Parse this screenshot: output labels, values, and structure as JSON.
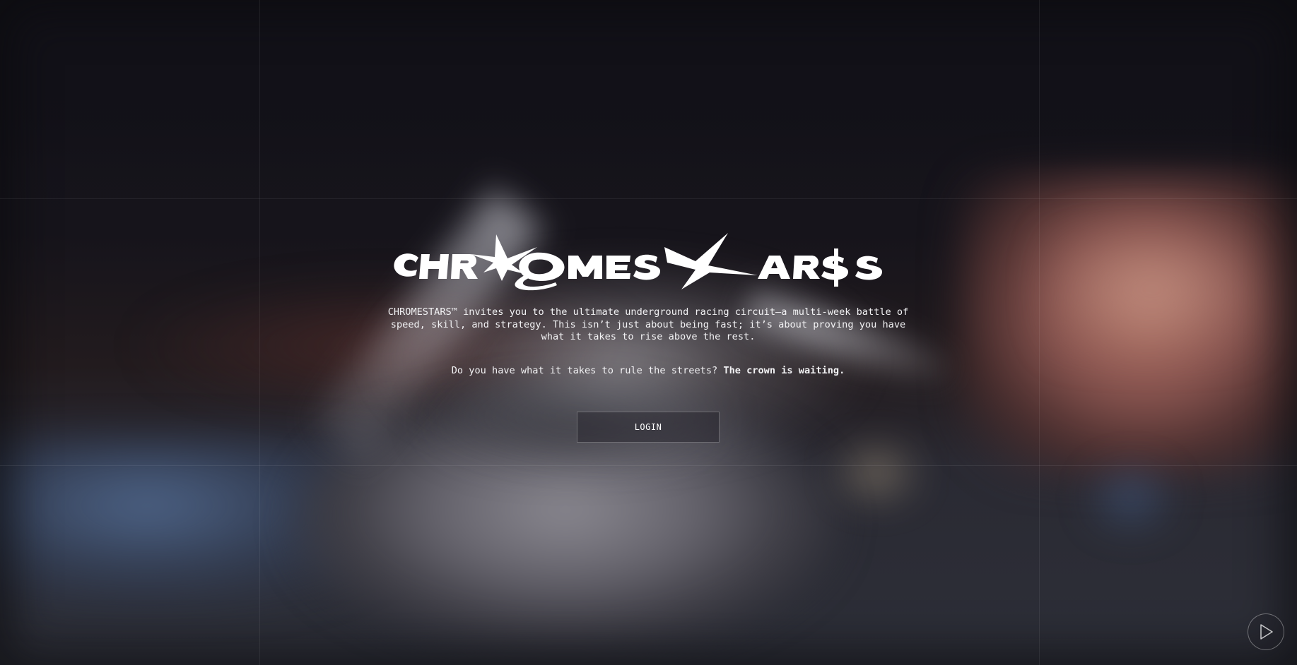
{
  "brand": {
    "logo_text": "CHROMESTARS"
  },
  "hero": {
    "intro": "CHROMESTARS™ invites you to the ultimate underground racing circuit—a multi-week battle of speed, skill, and strategy. This isn’t just about being fast; it’s about proving you have what it takes to rise above the rest.",
    "question": "Do you have what it takes to rule the streets?",
    "emphasis": "The crown is waiting.",
    "login_label": "LOGIN"
  },
  "controls": {
    "play_icon": "play-icon"
  },
  "colors": {
    "background": "#121118",
    "text": "#f2f2f4",
    "button_border": "rgba(255,255,255,0.28)"
  }
}
